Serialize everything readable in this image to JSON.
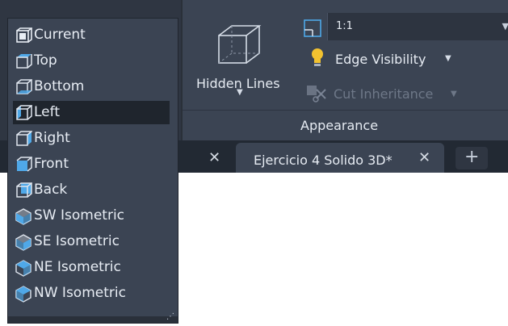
{
  "view_menu": {
    "items": [
      {
        "label": "Current",
        "icon": "current-view-icon"
      },
      {
        "label": "Top",
        "icon": "top-view-icon"
      },
      {
        "label": "Bottom",
        "icon": "bottom-view-icon"
      },
      {
        "label": "Left",
        "icon": "left-view-icon",
        "selected": true
      },
      {
        "label": "Right",
        "icon": "right-view-icon"
      },
      {
        "label": "Front",
        "icon": "front-view-icon"
      },
      {
        "label": "Back",
        "icon": "back-view-icon"
      },
      {
        "label": "SW Isometric",
        "icon": "sw-isometric-icon"
      },
      {
        "label": "SE Isometric",
        "icon": "se-isometric-icon"
      },
      {
        "label": "NE Isometric",
        "icon": "ne-isometric-icon"
      },
      {
        "label": "NW Isometric",
        "icon": "nw-isometric-icon"
      }
    ]
  },
  "ribbon": {
    "hidden_lines_label": "Hidden Lines",
    "ratio_value": "1:1",
    "edge_visibility_label": "Edge Visibility",
    "cut_inheritance_label": "Cut Inheritance",
    "panel_title": "Appearance"
  },
  "tabs": {
    "active_label": "Ejercicio 4 Solido 3D*",
    "close_glyph": "✕",
    "add_glyph": "+"
  },
  "colors": {
    "ribbon_bg": "#3b4453",
    "menu_bg": "#3b4453",
    "selected_bg": "#1f252d",
    "accent_blue": "#4fa8e8",
    "bulb_yellow": "#f2c230"
  }
}
